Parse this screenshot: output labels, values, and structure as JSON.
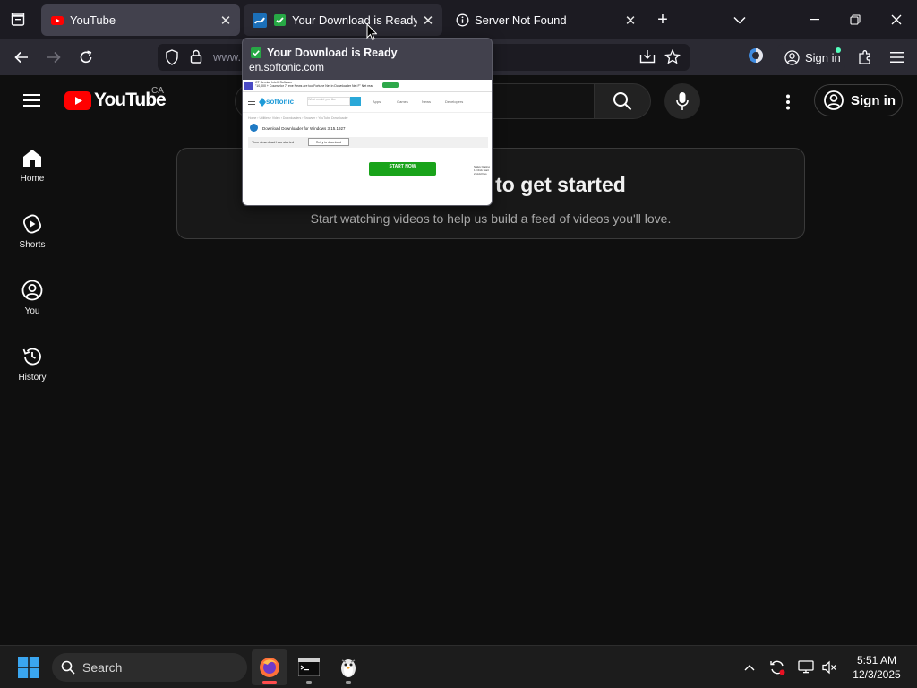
{
  "browser": {
    "tabs": [
      {
        "title": "YouTube",
        "state": "default"
      },
      {
        "title": "Your Download is Ready",
        "state": "hovered"
      },
      {
        "title": "Server Not Found",
        "state": "default"
      }
    ],
    "url_prefix": "www.",
    "signin_label": "Sign in"
  },
  "preview": {
    "title": "Your Download is Ready",
    "domain": "en.softonic.com",
    "thumb": {
      "brand": "softonic",
      "ad_text_1": "CT Service Intell. Software",
      "ad_text_2": "\"10,000 + Counselor 7\" exe News are too Fortune Net in Downloader Net F\" Net read",
      "search_placeholder": "What would you like",
      "nav": [
        "Apps",
        "Games",
        "News",
        "Developers"
      ],
      "crumbs": "Home › Utilities › Video › Downloaders › Browser › YouTube Downloader",
      "download_title": "Download Downloader for Windows 3.15.1927",
      "started": "Your download has started",
      "retry": "Retry to download",
      "start_now": "START NOW",
      "side_text": "Safety Rating\n1. Click Start\n2. Add files"
    }
  },
  "youtube": {
    "logo_text": "YouTube",
    "country": "CA",
    "signin_label": "Sign in",
    "guide": [
      {
        "label": "Home",
        "icon": "home-icon"
      },
      {
        "label": "Shorts",
        "icon": "shorts-icon"
      },
      {
        "label": "You",
        "icon": "you-icon"
      },
      {
        "label": "History",
        "icon": "history-icon"
      }
    ],
    "empty_heading": "Try searching to get started",
    "empty_sub": "Start watching videos to help us build a feed of videos you'll love."
  },
  "taskbar": {
    "search_label": "Search",
    "time": "5:51 AM",
    "date": "12/3/2025"
  },
  "colors": {
    "tabstrip": "#1c1b22",
    "toolbar": "#2b2a33",
    "yt_red": "#ff0000",
    "page_bg": "#0f0f0f",
    "start_now": "#19a31a"
  }
}
